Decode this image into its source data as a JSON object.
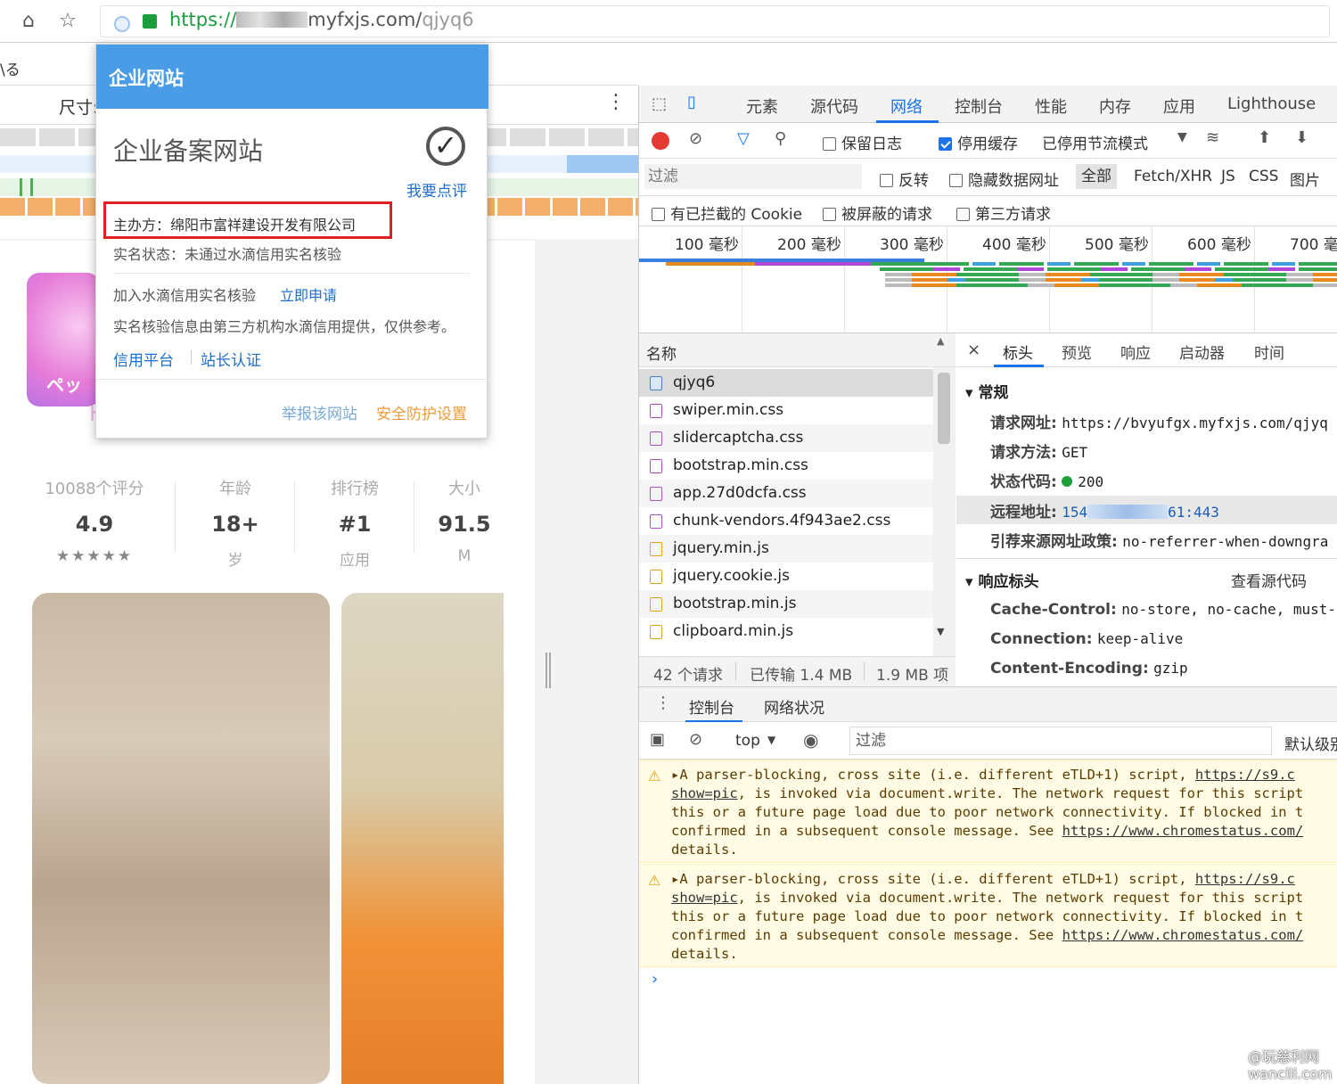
{
  "browser": {
    "url_scheme": "https://",
    "url_domain": "myfxjs.com/",
    "url_path": "qjyq6"
  },
  "left_page": {
    "tab_text": "\\る",
    "size_label": "尺寸:",
    "app_stats": [
      {
        "label": "10088个评分",
        "value": "4.9",
        "sub": "★★★★★"
      },
      {
        "label": "年龄",
        "value": "18+",
        "sub": "岁"
      },
      {
        "label": "排行榜",
        "value": "#1",
        "sub": "应用"
      },
      {
        "label": "大小",
        "value": "91.5",
        "sub": "M"
      }
    ],
    "app_icon_text": "ペッ",
    "app_icon_text2": "ト"
  },
  "popup": {
    "header": "企业网站",
    "title": "企业备案网站",
    "review_link": "我要点评",
    "organizer": "主办方：绵阳市富祥建设开发有限公司",
    "realname_status": "实名状态：未通过水滴信用实名核验",
    "join_text": "加入水滴信用实名核验",
    "apply_link": "立即申请",
    "note": "实名核验信息由第三方机构水滴信用提供，仅供参考。",
    "credit_link": "信用平台",
    "cert_link": "站长认证",
    "report_link": "举报该网站",
    "safety_link": "安全防护设置"
  },
  "devtools": {
    "tabs": [
      "元素",
      "源代码",
      "网络",
      "控制台",
      "性能",
      "内存",
      "应用",
      "Lighthouse"
    ],
    "active_tab": "网络",
    "toolbar": {
      "preserve_log": "保留日志",
      "disable_cache": "停用缓存",
      "throttle": "已停用节流模式"
    },
    "filter": {
      "placeholder": "过滤",
      "invert": "反转",
      "hide_data_urls": "隐藏数据网址",
      "types": [
        "全部",
        "Fetch/XHR",
        "JS",
        "CSS",
        "图片"
      ],
      "blocked_cookies": "有已拦截的 Cookie",
      "blocked_requests": "被屏蔽的请求",
      "third_party": "第三方请求"
    },
    "timeline_ticks": [
      "100 毫秒",
      "200 毫秒",
      "300 毫秒",
      "400 毫秒",
      "500 毫秒",
      "600 毫秒",
      "700 毫"
    ],
    "request_list": {
      "header": "名称",
      "items": [
        {
          "name": "qjyq6",
          "type": "doc"
        },
        {
          "name": "swiper.min.css",
          "type": "css"
        },
        {
          "name": "slidercaptcha.css",
          "type": "css"
        },
        {
          "name": "bootstrap.min.css",
          "type": "css"
        },
        {
          "name": "app.27d0dcfa.css",
          "type": "css"
        },
        {
          "name": "chunk-vendors.4f943ae2.css",
          "type": "css"
        },
        {
          "name": "jquery.min.js",
          "type": "js"
        },
        {
          "name": "jquery.cookie.js",
          "type": "js"
        },
        {
          "name": "bootstrap.min.js",
          "type": "js"
        },
        {
          "name": "clipboard.min.js",
          "type": "js"
        }
      ],
      "footer": [
        "42 个请求",
        "已传输 1.4 MB",
        "1.9 MB 项"
      ]
    },
    "headers_panel": {
      "tabs": [
        "标头",
        "预览",
        "响应",
        "启动器",
        "时间"
      ],
      "general_title": "常规",
      "general": [
        {
          "key": "请求网址:",
          "value": "https://bvyufgx.myfxjs.com/qjyq"
        },
        {
          "key": "请求方法:",
          "value": "GET"
        },
        {
          "key": "状态代码:",
          "value": "200"
        },
        {
          "key": "远程地址:",
          "value_prefix": "154",
          "value_suffix": "61:443"
        },
        {
          "key": "引荐来源网址政策:",
          "value": "no-referrer-when-downgra"
        }
      ],
      "response_title": "响应标头",
      "view_source": "查看源代码",
      "response": [
        {
          "key": "Cache-Control:",
          "value": "no-store, no-cache, must-r"
        },
        {
          "key": "Connection:",
          "value": "keep-alive"
        },
        {
          "key": "Content-Encoding:",
          "value": "gzip"
        }
      ]
    },
    "console": {
      "tabs": [
        "控制台",
        "网络状况"
      ],
      "context": "top",
      "filter_placeholder": "过滤",
      "level": "默认级别",
      "messages": [
        {
          "lines": [
            "▸A parser-blocking, cross site (i.e. different eTLD+1) script, ",
            "show=pic",
            ", is invoked via document.write. The network request for this script",
            "this or a future page load due to poor network connectivity. If blocked in t",
            "confirmed in a subsequent console message. See ",
            "details."
          ],
          "link1": "https://s9.c",
          "link2": "https://www.chromestatus.com/"
        },
        {
          "lines": [
            "▸A parser-blocking, cross site (i.e. different eTLD+1) script, ",
            "show=pic",
            ", is invoked via document.write. The network request for this script",
            "this or a future page load due to poor network connectivity. If blocked in t",
            "confirmed in a subsequent console message. See ",
            "details."
          ],
          "link1": "https://s9.c",
          "link2": "https://www.chromestatus.com/"
        }
      ],
      "prompt": "›"
    }
  },
  "watermark": {
    "line1": "@玩慈利网",
    "line2": "wancili.com"
  },
  "colors": {
    "accent": "#1a73e8",
    "popup_header": "#4a9ce6",
    "highlight_box": "#e02020",
    "warning_bg": "#fffbe5"
  }
}
